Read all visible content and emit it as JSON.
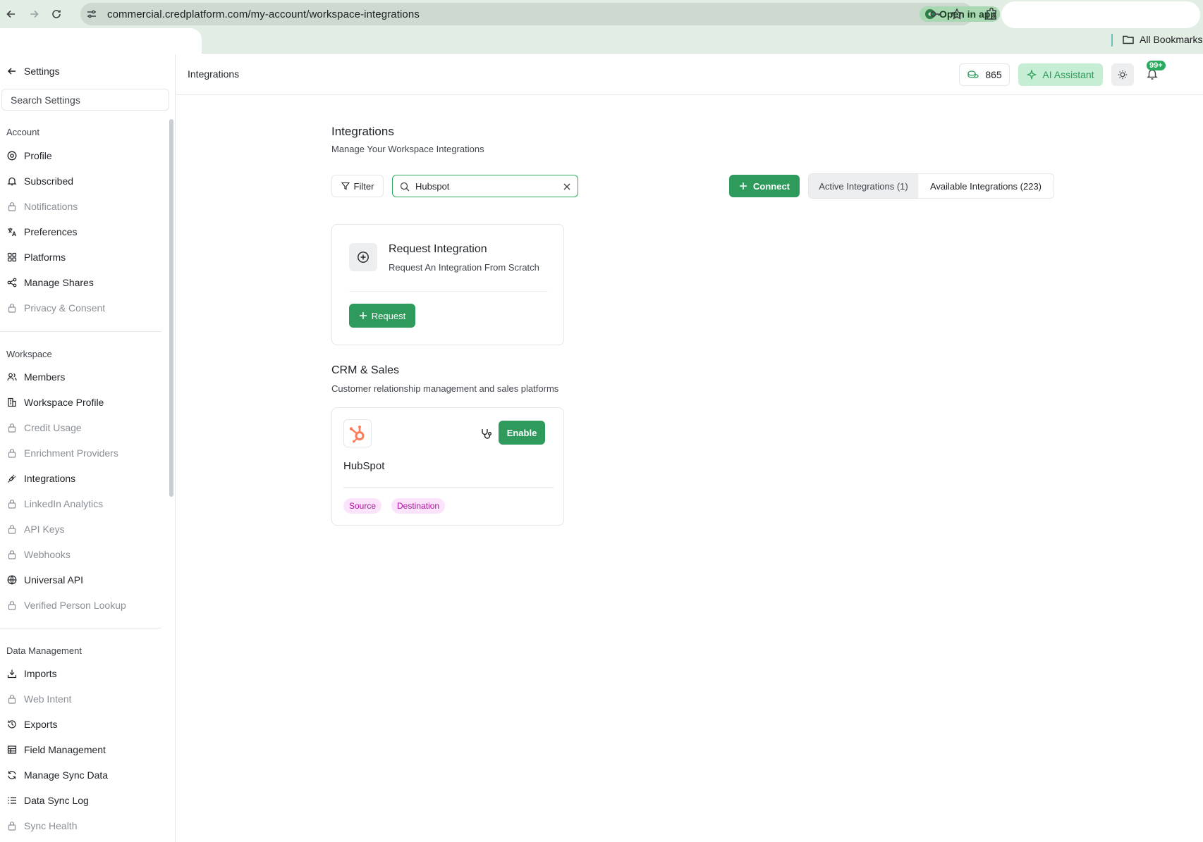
{
  "browser": {
    "url": "commercial.credplatform.com/my-account/workspace-integrations",
    "open_in_app": "Open in app",
    "all_bookmarks": "All Bookmarks"
  },
  "sidebar": {
    "back_label": "Settings",
    "search_placeholder": "Search Settings",
    "sections": [
      {
        "title": "Account",
        "items": [
          {
            "label": "Profile",
            "icon": "at-icon",
            "disabled": false
          },
          {
            "label": "Subscribed",
            "icon": "bell-icon",
            "disabled": false
          },
          {
            "label": "Notifications",
            "icon": "lock-icon",
            "disabled": true
          },
          {
            "label": "Preferences",
            "icon": "translate-icon",
            "disabled": false
          },
          {
            "label": "Platforms",
            "icon": "grid-icon",
            "disabled": false
          },
          {
            "label": "Manage Shares",
            "icon": "share-icon",
            "disabled": false
          },
          {
            "label": "Privacy & Consent",
            "icon": "lock-icon",
            "disabled": true
          }
        ]
      },
      {
        "title": "Workspace",
        "items": [
          {
            "label": "Members",
            "icon": "users-icon",
            "disabled": false
          },
          {
            "label": "Workspace Profile",
            "icon": "building-icon",
            "disabled": false
          },
          {
            "label": "Credit Usage",
            "icon": "lock-icon",
            "disabled": true
          },
          {
            "label": "Enrichment Providers",
            "icon": "lock-icon",
            "disabled": true
          },
          {
            "label": "Integrations",
            "icon": "plug-icon",
            "disabled": false
          },
          {
            "label": "LinkedIn Analytics",
            "icon": "lock-icon",
            "disabled": true
          },
          {
            "label": "API Keys",
            "icon": "lock-icon",
            "disabled": true
          },
          {
            "label": "Webhooks",
            "icon": "lock-icon",
            "disabled": true
          },
          {
            "label": "Universal API",
            "icon": "globe-icon",
            "disabled": false
          },
          {
            "label": "Verified Person Lookup",
            "icon": "lock-icon",
            "disabled": true
          }
        ]
      },
      {
        "title": "Data Management",
        "items": [
          {
            "label": "Imports",
            "icon": "import-icon",
            "disabled": false
          },
          {
            "label": "Web Intent",
            "icon": "lock-icon",
            "disabled": true
          },
          {
            "label": "Exports",
            "icon": "history-icon",
            "disabled": false
          },
          {
            "label": "Field Management",
            "icon": "table-icon",
            "disabled": false
          },
          {
            "label": "Manage Sync Data",
            "icon": "refresh-icon",
            "disabled": false
          },
          {
            "label": "Data Sync Log",
            "icon": "list-icon",
            "disabled": false
          },
          {
            "label": "Sync Health",
            "icon": "lock-icon",
            "disabled": true
          }
        ]
      }
    ]
  },
  "topbar": {
    "title": "Integrations",
    "credits": "865",
    "ai_assistant": "AI Assistant",
    "notification_badge": "99+"
  },
  "main": {
    "title": "Integrations",
    "subtitle": "Manage Your Workspace Integrations",
    "filter_label": "Filter",
    "search_value": "Hubspot",
    "connect_label": "Connect",
    "tabs": [
      {
        "label": "Active Integrations (1)",
        "active": false
      },
      {
        "label": "Available Integrations (223)",
        "active": true
      }
    ],
    "request_card": {
      "title": "Request Integration",
      "subtitle": "Request An Integration From Scratch",
      "button": "Request"
    },
    "section": {
      "title": "CRM & Sales",
      "subtitle": "Customer relationship management and sales platforms"
    },
    "hubspot_card": {
      "name": "HubSpot",
      "enable": "Enable",
      "tags": [
        "Source",
        "Destination"
      ],
      "brand_color": "#ff7a59"
    }
  },
  "colors": {
    "accent_green": "#2e9a5c",
    "tag_bg": "#fbe3fb",
    "tag_text": "#b0129e"
  }
}
